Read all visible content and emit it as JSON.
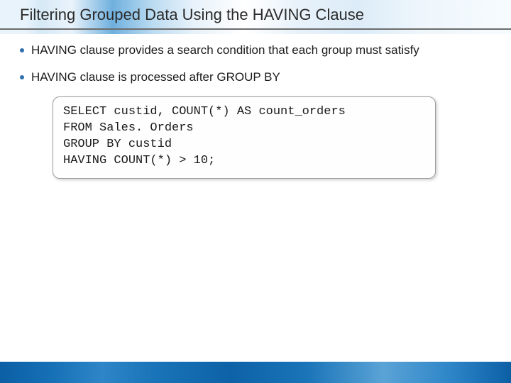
{
  "title": "Filtering Grouped Data Using the HAVING Clause",
  "bullets": [
    "HAVING clause provides a search condition that each group must satisfy",
    "HAVING clause is processed after GROUP BY"
  ],
  "code": "SELECT custid, COUNT(*) AS count_orders\nFROM Sales. Orders\nGROUP BY custid\nHAVING COUNT(*) > 10;"
}
